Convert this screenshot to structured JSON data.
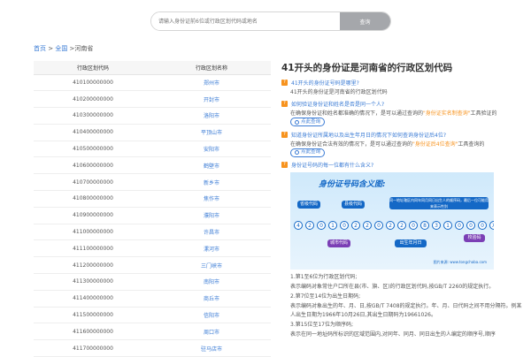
{
  "search": {
    "placeholder": "请输入身份证前6位或行政区划代码或地名",
    "button": "查询"
  },
  "breadcrumb": {
    "home": "首页",
    "sep1": " > ",
    "all": "全国",
    "sep2": " >",
    "current": "河南省"
  },
  "table": {
    "headers": [
      "行政区划代码",
      "行政区划名称"
    ],
    "rows": [
      [
        "410100000000",
        "郑州市"
      ],
      [
        "410200000000",
        "开封市"
      ],
      [
        "410300000000",
        "洛阳市"
      ],
      [
        "410400000000",
        "平顶山市"
      ],
      [
        "410500000000",
        "安阳市"
      ],
      [
        "410600000000",
        "鹤壁市"
      ],
      [
        "410700000000",
        "新乡市"
      ],
      [
        "410800000000",
        "焦作市"
      ],
      [
        "410900000000",
        "濮阳市"
      ],
      [
        "411000000000",
        "许昌市"
      ],
      [
        "411100000000",
        "漯河市"
      ],
      [
        "411200000000",
        "三门峡市"
      ],
      [
        "411300000000",
        "南阳市"
      ],
      [
        "411400000000",
        "商丘市"
      ],
      [
        "411500000000",
        "信阳市"
      ],
      [
        "411600000000",
        "周口市"
      ],
      [
        "411700000000",
        "驻马店市"
      ]
    ]
  },
  "article": {
    "title": "41开头的身份证是河南省的行政区划代码",
    "q1": "41开头的身份证号码是哪里?",
    "a1": "41开头的身份证是河南省的行政区划代码",
    "q2": "如何验证身份证和姓名是否是同一个人?",
    "a2_pre": "在确保身份证和姓名都准确的情况下，是可以通过查询的",
    "a2_hl": "\"身份证实名制查询\"",
    "a2_post": "工具验证的",
    "btn": "点此查询",
    "q3": "知道身份证所属地以及出生年月日的情况下如何查询身份证后4位?",
    "a3_pre": "在确保身份证合法有效的情况下，是可以通过查询的",
    "a3_hl": "\"身份证后4位查询\"",
    "a3_post": "工具查询的",
    "q4": "身份证号码的每一位都有什么含义?",
    "img_title": "身份证号码含义图:",
    "img_tag1": "省级代码",
    "img_tag2": "县级代码",
    "img_tag3": "同一地址辖区内同年同月同日出生人的顺序码，最后一位可能用来表示性别",
    "img_tag4": "城市代码",
    "img_tag5": "出生年月日",
    "img_tag6": "校验码",
    "img_digits": [
      "4",
      "2",
      "0",
      "1",
      "0",
      "2",
      "2",
      "0",
      "2",
      "2",
      "0",
      "8",
      "3",
      "1",
      "0",
      "0",
      "0",
      "X"
    ],
    "img_src": "图片来源: www.tongchaba.com",
    "p1": "1.第1至6位为行政区划代码;",
    "p2": "表示编码对象常住户口所在县(市、旗、区)的行政区划代码,按GB/T 2260的规定执行。",
    "p3": "2.第7位至14位为出生日期码;",
    "p4": "表示编码对象出生的年、月、日,按GB/T 7408的规定执行。年、月、日代码之间不用分隔符。例某人出生日期为1966年10月26日,其出生日期码为19661026。",
    "p5": "3.第15位至17位为顺序码;",
    "p6": "表示在同一地址码所标识的区域范围内,对同年、同月、同日出生的人编定的顺序号,顺序"
  },
  "colors": {
    "accent": "#3a7bd5",
    "orange": "#f7931e",
    "search_btn": "#a5a7ab"
  }
}
